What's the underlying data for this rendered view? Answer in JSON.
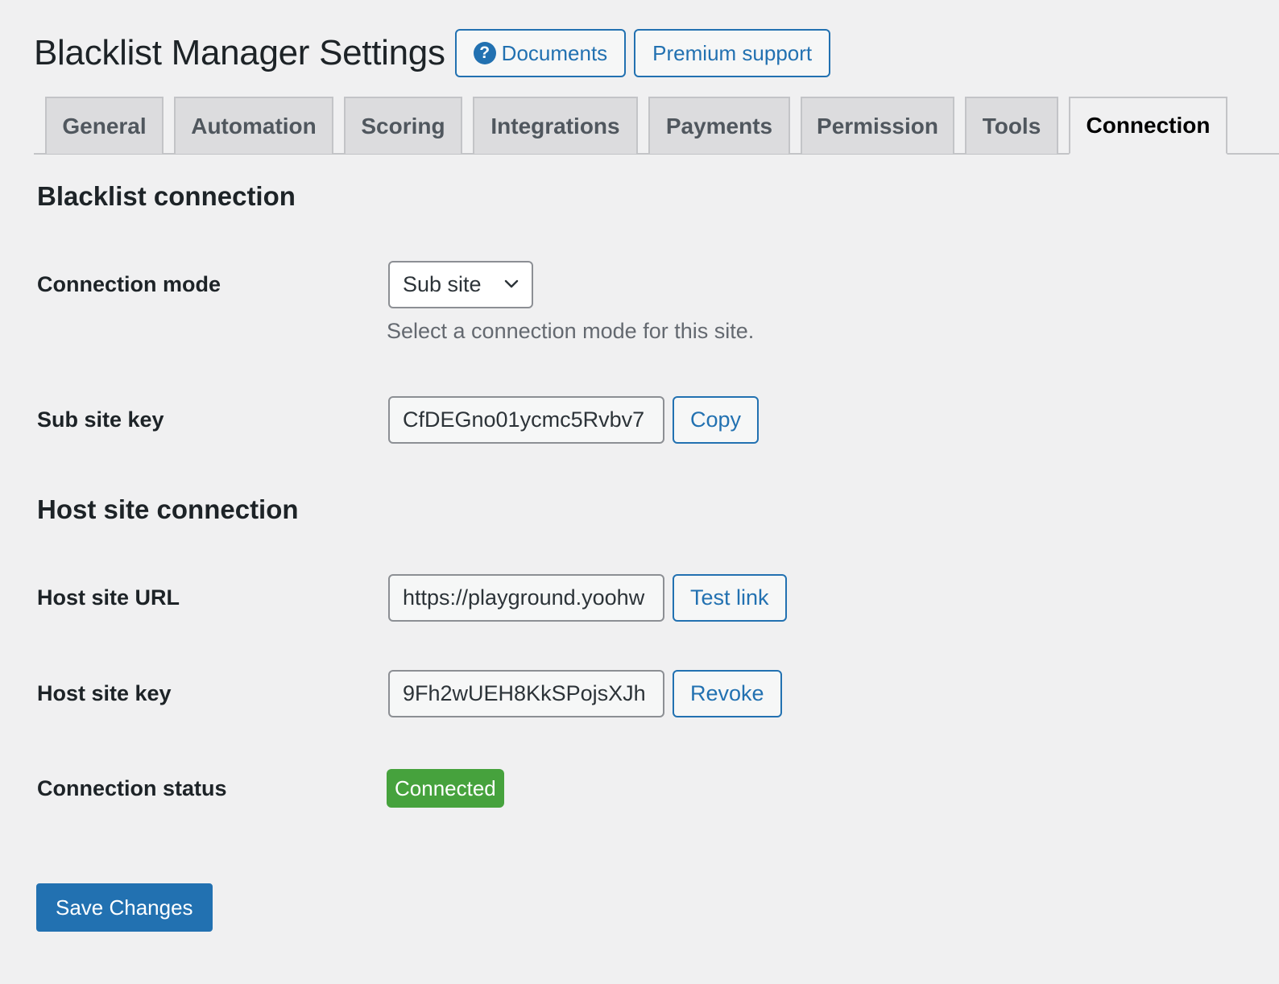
{
  "header": {
    "title": "Blacklist Manager Settings",
    "documents_icon": "?",
    "documents_label": "Documents",
    "support_label": "Premium support"
  },
  "tabs": [
    {
      "label": "General",
      "active": false
    },
    {
      "label": "Automation",
      "active": false
    },
    {
      "label": "Scoring",
      "active": false
    },
    {
      "label": "Integrations",
      "active": false
    },
    {
      "label": "Payments",
      "active": false
    },
    {
      "label": "Permission",
      "active": false
    },
    {
      "label": "Tools",
      "active": false
    },
    {
      "label": "Connection",
      "active": true
    }
  ],
  "blacklist_connection": {
    "title": "Blacklist connection",
    "mode": {
      "label": "Connection mode",
      "value": "Sub site",
      "description": "Select a connection mode for this site."
    },
    "sub_site_key": {
      "label": "Sub site key",
      "value": "CfDEGno01ycmc5Rvbv7",
      "button": "Copy"
    }
  },
  "host_site_connection": {
    "title": "Host site connection",
    "url": {
      "label": "Host site URL",
      "value": "https://playground.yoohw",
      "button": "Test link"
    },
    "key": {
      "label": "Host site key",
      "value": "9Fh2wUEH8KkSPojsXJh",
      "button": "Revoke"
    },
    "status": {
      "label": "Connection status",
      "value": "Connected",
      "color": "#46a23d"
    }
  },
  "footer": {
    "save_label": "Save Changes"
  },
  "colors": {
    "accent": "#2271b1",
    "background": "#f0f0f1",
    "success": "#46a23d"
  }
}
